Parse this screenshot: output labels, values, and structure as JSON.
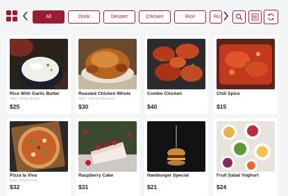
{
  "accent_color": "#9b1b30",
  "header": {
    "menu_icon": "grid-icon",
    "prev_icon": "chevron-left-icon",
    "next_icon": "chevron-right-icon",
    "categories": [
      {
        "label": "All",
        "active": true
      },
      {
        "label": "Drink",
        "active": false
      },
      {
        "label": "Dessert",
        "active": false
      },
      {
        "label": "Chicken",
        "active": false
      },
      {
        "label": "Rice",
        "active": false
      },
      {
        "label": "Ric",
        "active": false
      }
    ],
    "tools": [
      "search-icon",
      "barcode-icon",
      "refresh-icon"
    ]
  },
  "products": [
    {
      "name": "Rice With Garlic Butter",
      "addon": "Add : Extra Butter",
      "price": "$25"
    },
    {
      "name": "Roasted Chicken Whole",
      "addon": "Add : Honey Mustard",
      "price": "$30"
    },
    {
      "name": "Combo Chicken",
      "addon": "",
      "price": "$40"
    },
    {
      "name": "Chili Spice",
      "addon": "",
      "price": "$15"
    },
    {
      "name": "Pizza la Viva",
      "addon": "Add : Mushroom",
      "price": "$32"
    },
    {
      "name": "Raspberry Cake",
      "addon": "",
      "price": "$31"
    },
    {
      "name": "Hamburger Special",
      "addon": "",
      "price": "$21"
    },
    {
      "name": "Fruit Salad Yoghurt",
      "addon": "",
      "price": "$24"
    }
  ]
}
